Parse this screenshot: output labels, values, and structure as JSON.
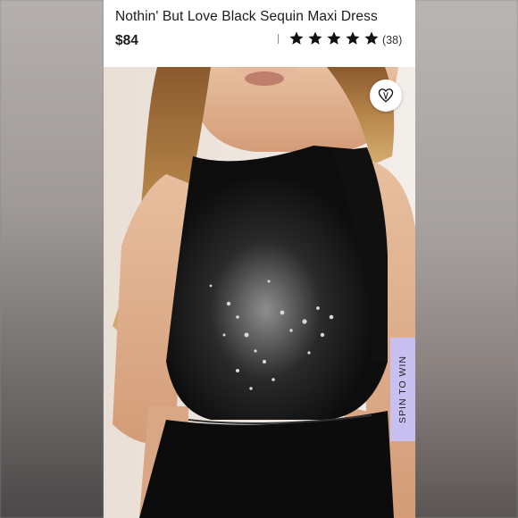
{
  "product": {
    "title": "Nothin' But Love Black Sequin Maxi Dress",
    "price": "$84",
    "rating": 5,
    "rating_max": 5,
    "review_count": "(38)"
  },
  "actions": {
    "favorite_icon": "heart-icon",
    "spin_to_win_label": "SPIN TO WIN"
  },
  "colors": {
    "accent_tab": "#c8c0f0",
    "star": "#111111"
  }
}
